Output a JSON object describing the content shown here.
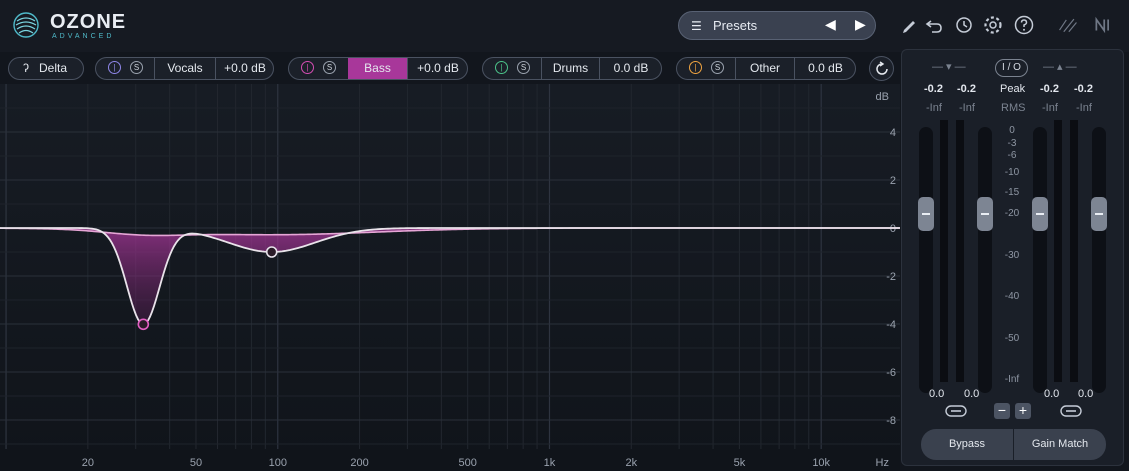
{
  "app": {
    "name": "OZONE",
    "edition": "ADVANCED"
  },
  "toolbar": {
    "presets_label": "Presets",
    "icons": [
      "pencil-icon",
      "undo-icon",
      "history-icon",
      "gear-icon",
      "help-icon",
      "signal-chain-icon",
      "ni-logo-icon"
    ]
  },
  "tracks": {
    "delta_label": "Delta",
    "sources": [
      {
        "name": "Vocals",
        "gain": "+0.0 dB",
        "color": "#8f86e8",
        "selected": false
      },
      {
        "name": "Bass",
        "gain": "+0.0 dB",
        "color": "#d44db3",
        "selected": true
      },
      {
        "name": "Drums",
        "gain": "0.0 dB",
        "color": "#4cc38a",
        "selected": false
      },
      {
        "name": "Other",
        "gain": "0.0 dB",
        "color": "#f0a441",
        "selected": false
      }
    ],
    "solo_label": "S"
  },
  "eq": {
    "db_unit": "dB",
    "db_ticks": [
      "4",
      "2",
      "0",
      "-2",
      "-4",
      "-6",
      "-8"
    ],
    "freq_ticks": [
      "20",
      "50",
      "100",
      "200",
      "500",
      "1k",
      "2k",
      "5k",
      "10k"
    ],
    "hz_unit": "Hz",
    "curve_color": "#c1449f",
    "nodes": [
      {
        "freq_hz": 32,
        "gain_db": -4.0
      },
      {
        "freq_hz": 95,
        "gain_db": -1.0
      }
    ]
  },
  "meters": {
    "io_label": "I / O",
    "peak_label": "Peak",
    "rms_label": "RMS",
    "input_peak": [
      "-0.2",
      "-0.2"
    ],
    "output_peak": [
      "-0.2",
      "-0.2"
    ],
    "input_rms": [
      "-Inf",
      "-Inf"
    ],
    "output_rms": [
      "-Inf",
      "-Inf"
    ],
    "scale": [
      "0",
      "-3",
      "-6",
      "-10",
      "-15",
      "-20",
      "-30",
      "-40",
      "-50",
      "-Inf"
    ],
    "input_gain": [
      "0.0",
      "0.0"
    ],
    "output_gain": [
      "0.0",
      "0.0"
    ],
    "minus_label": "−",
    "plus_label": "+",
    "bypass_label": "Bypass",
    "gain_match_label": "Gain Match"
  }
}
